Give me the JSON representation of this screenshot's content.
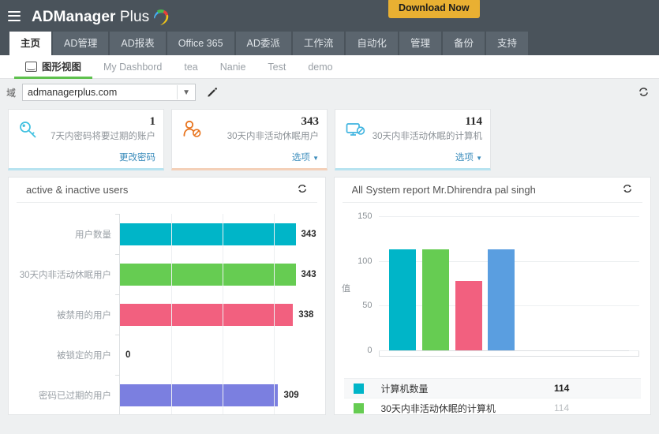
{
  "topbar": {
    "menu_icon": "hamburger-icon",
    "brand_bold": "ADManager",
    "brand_light": " Plus",
    "download_label": "Download Now",
    "bg_color": "#4a535b",
    "download_color": "#e9b032"
  },
  "main_tabs": [
    {
      "label": "主页",
      "active": true
    },
    {
      "label": "AD管理",
      "active": false
    },
    {
      "label": "AD报表",
      "active": false
    },
    {
      "label": "Office 365",
      "active": false
    },
    {
      "label": "AD委派",
      "active": false
    },
    {
      "label": "工作流",
      "active": false
    },
    {
      "label": "自动化",
      "active": false
    },
    {
      "label": "管理",
      "active": false
    },
    {
      "label": "备份",
      "active": false
    },
    {
      "label": "支持",
      "active": false
    }
  ],
  "sub_tabs": [
    {
      "label": "图形视图",
      "active": true,
      "icon": "chart-view-icon"
    },
    {
      "label": "My Dashbord",
      "active": false
    },
    {
      "label": "tea",
      "active": false
    },
    {
      "label": "Nanie",
      "active": false
    },
    {
      "label": "Test",
      "active": false
    },
    {
      "label": "demo",
      "active": false
    }
  ],
  "domain_row": {
    "label": "域",
    "selected": "admanagerplus.com",
    "placeholder": "admanagerplus.com",
    "edit_icon": "pencil-icon",
    "refresh_icon": "refresh-icon"
  },
  "cards": [
    {
      "value": "1",
      "label": "7天内密码将要过期的账户",
      "action": "更改密码",
      "icon": "key-icon",
      "icon_color": "#3fc0e0",
      "accent": "#b7e3f0",
      "has_caret": false
    },
    {
      "value": "343",
      "label": "30天内非活动休眠用户",
      "action": "选项",
      "icon": "user-disabled-icon",
      "icon_color": "#e8741e",
      "accent": "#f4d0b8",
      "has_caret": true
    },
    {
      "value": "114",
      "label": "30天内非活动休眠的计算机",
      "action": "选项",
      "icon": "computer-disabled-icon",
      "icon_color": "#3fb4e0",
      "accent": "#b7e3f0",
      "has_caret": true
    }
  ],
  "panels": {
    "left": {
      "title": "active & inactive users",
      "refresh_icon": "refresh-icon"
    },
    "right": {
      "title": "All System report Mr.Dhirendra pal singh",
      "refresh_icon": "refresh-icon"
    }
  },
  "chart_data": [
    {
      "type": "bar",
      "orientation": "horizontal",
      "title": "active & inactive users",
      "xlabel": "",
      "ylabel": "",
      "xlim": [
        0,
        400
      ],
      "grid": true,
      "categories": [
        "用户数量",
        "30天内非活动休眠用户",
        "被禁用的用户",
        "被锁定的用户",
        "密码已过期的用户"
      ],
      "values": [
        343,
        343,
        338,
        0,
        309
      ],
      "colors": [
        "#00b5c8",
        "#66cc52",
        "#f2607f",
        "#f2607f",
        "#7b7fe0"
      ],
      "data_labels": [
        "343",
        "343",
        "338",
        "0",
        "309"
      ]
    },
    {
      "type": "bar",
      "orientation": "vertical",
      "title": "All System report Mr.Dhirendra pal singh",
      "xlabel": "",
      "ylabel": "值",
      "ylim": [
        0,
        150
      ],
      "yticks": [
        0,
        50,
        100,
        150
      ],
      "grid": true,
      "categories": [
        "计算机数量",
        "30天内非活动休眠的计算机",
        "",
        ""
      ],
      "values": [
        114,
        114,
        78,
        114
      ],
      "colors": [
        "#00b5c8",
        "#66cc52",
        "#f2607f",
        "#5a9ee0"
      ]
    }
  ],
  "legend": {
    "rows": [
      {
        "name": "计算机数量",
        "value": "114",
        "color": "#00b5c8",
        "dim": false
      },
      {
        "name": "30天内非活动休眠的计算机",
        "value": "114",
        "color": "#66cc52",
        "dim": true
      }
    ]
  }
}
